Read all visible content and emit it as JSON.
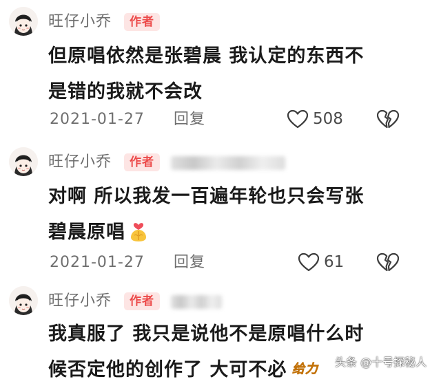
{
  "comments": [
    {
      "username": "旺仔小乔",
      "badge": "作者",
      "lines": [
        "但原唱依然是张碧晨 我认定的东西不",
        "是错的我就不会改"
      ],
      "date": "2021-01-27",
      "reply_label": "回复",
      "like_count": "508"
    },
    {
      "username": "旺仔小乔",
      "badge": "作者",
      "lines": [
        "对啊 所以我发一百遍年轮也只会写张",
        "碧晨原唱"
      ],
      "date": "2021-01-27",
      "reply_label": "回复",
      "like_count": "61"
    },
    {
      "username": "旺仔小乔",
      "badge": "作者",
      "lines": [
        "我真服了 我只是说他不是原唱什么时",
        "候否定他的创作了 大可不必"
      ]
    }
  ],
  "sticker_text": "给力",
  "watermark": "头条 @十号探秘人",
  "colors": {
    "badge_bg": "#fde5e4",
    "badge_text": "#ec4a4a",
    "meta_text": "#6f6f6f",
    "body_text": "#1a1a1a"
  },
  "icons": {
    "like": "heart-outline-icon",
    "dislike": "broken-heart-icon",
    "avatar": "cartoon-girl-avatar",
    "emoji": "pray-hands-heart-emoji"
  }
}
